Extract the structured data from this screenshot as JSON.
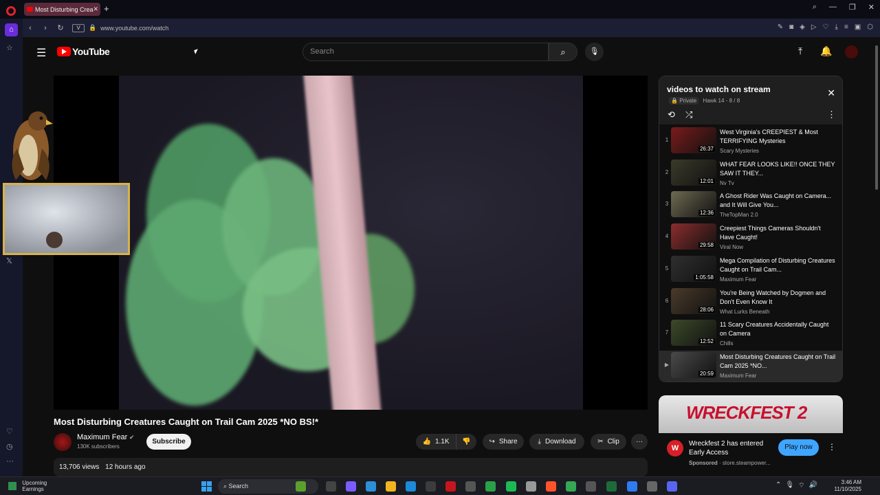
{
  "browser": {
    "tab_title": "Most Disturbing Crea",
    "url": "www.youtube.com/watch",
    "url_chip": "V"
  },
  "youtube": {
    "logo_text": "YouTube",
    "search_placeholder": "Search"
  },
  "video": {
    "title": "Most Disturbing Creatures Caught on Trail Cam 2025 *NO BS!*",
    "channel": "Maximum Fear",
    "subscribers": "130K subscribers",
    "subscribe_label": "Subscribe",
    "likes": "1.1K",
    "share_label": "Share",
    "download_label": "Download",
    "clip_label": "Clip",
    "views": "13,706 views",
    "age": "12 hours ago"
  },
  "playlist": {
    "title": "videos to watch on stream",
    "privacy": "Private",
    "owner": "Hawk 14",
    "position": "- 8 / 8",
    "items": [
      {
        "num": "1",
        "title": "West Virginia's CREEPIEST & Most TERRIFYING Mysteries",
        "channel": "Scary Mysteries",
        "duration": "26:37",
        "color": "#7a1b1b"
      },
      {
        "num": "2",
        "title": "WHAT FEAR LOOKS LIKE!! ONCE THEY SAW IT THEY...",
        "channel": "Nv Tv",
        "duration": "12:01",
        "color": "#3b3a2a"
      },
      {
        "num": "3",
        "title": "A Ghost Rider Was Caught on Camera... and It Will Give You...",
        "channel": "TheTopMan 2.0",
        "duration": "12:36",
        "color": "#6e6a52"
      },
      {
        "num": "4",
        "title": "Creepiest Things Cameras Shouldn't Have Caught!",
        "channel": "Viral Now",
        "duration": "29:58",
        "color": "#8b2d2d"
      },
      {
        "num": "5",
        "title": "Mega Compilation of Disturbing Creatures Caught on Trail Cam...",
        "channel": "Maximum Fear",
        "duration": "1:05:58",
        "color": "#2f2f2f"
      },
      {
        "num": "6",
        "title": "You're Being Watched by Dogmen and Don't Even Know It",
        "channel": "What Lurks Beneath",
        "duration": "28:06",
        "color": "#4a3b2a"
      },
      {
        "num": "7",
        "title": "11 Scary Creatures Accidentally Caught on Camera",
        "channel": "Chills",
        "duration": "12:52",
        "color": "#3c4a2a"
      },
      {
        "num": "▶",
        "title": "Most Disturbing Creatures Caught on Trail Cam 2025 *NO...",
        "channel": "Maximum Fear",
        "duration": "20:59",
        "color": "#4a4a4a"
      }
    ]
  },
  "ad": {
    "banner_text": "WRECKFEST 2",
    "text": "Wreckfest 2 has entered Early Access",
    "sponsored": "Sponsored",
    "domain": "· store.steampower...",
    "cta": "Play now"
  },
  "taskbar": {
    "weather_title": "Upcoming",
    "weather_sub": "Earnings",
    "search": "Search",
    "time": "3:46 AM",
    "date": "11/10/2025"
  }
}
